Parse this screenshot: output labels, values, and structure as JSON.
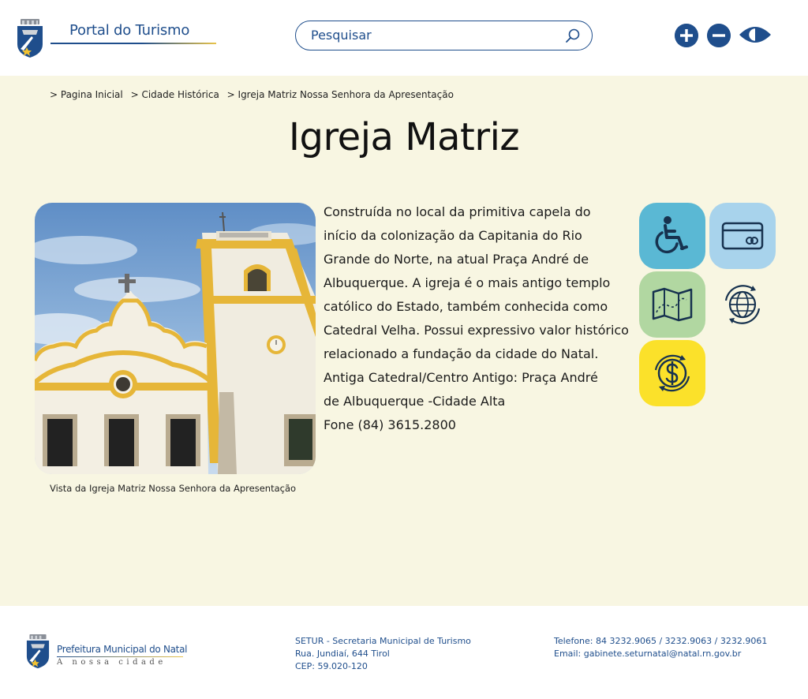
{
  "header": {
    "logo_text": "Portal do Turismo",
    "search_placeholder": "Pesquisar",
    "accessibility": {
      "increase_font": "+",
      "decrease_font": "−",
      "contrast": "contrast"
    }
  },
  "breadcrumb": [
    "> Pagina Inicial",
    "> Cidade Histórica",
    "> Igreja Matriz Nossa Senhora da Apresentação"
  ],
  "page": {
    "title": "Igreja Matriz",
    "photo_caption": "Vista da Igreja Matriz Nossa Senhora da Apresentação",
    "description": "Construída no local da primitiva capela do\ninício da colonização da Capitania do Rio\nGrande do Norte, na atual Praça André de\nAlbuquerque. A igreja é o mais antigo templo\ncatólico do Estado, também conhecida como\nCatedral Velha. Possui expressivo valor histórico\nrelacionado a  fundação da cidade do Natal.\n Antiga Catedral/Centro Antigo: Praça André\nde Albuquerque -Cidade Alta\nFone (84) 3615.2800"
  },
  "features": [
    {
      "icon": "wheelchair-icon",
      "color": "#5ab8d4"
    },
    {
      "icon": "credit-card-icon",
      "color": "#a8d3ec"
    },
    {
      "icon": "map-icon",
      "color": "#b1d7a1"
    },
    {
      "icon": "globe-icon",
      "color": "transparent"
    },
    {
      "icon": "currency-exchange-icon",
      "color": "#fbe12a"
    }
  ],
  "footer": {
    "logo_title": "Prefeitura Municipal do Natal",
    "logo_subtitle": "A nossa cidade",
    "setur_lines": [
      "SETUR - Secretaria Municipal de Turismo",
      "Rua. Jundiaí, 644 Tirol",
      "CEP: 59.020-120"
    ],
    "contact_lines": [
      "Telefone: 84 3232.9065 / 3232.9063 / 3232.9061",
      "Email: gabinete.seturnatal@natal.rn.gov.br"
    ]
  },
  "colors": {
    "brand_blue": "#1f4e8c",
    "page_background": "#f8f6e2",
    "accent_gold": "#e8c34a"
  }
}
